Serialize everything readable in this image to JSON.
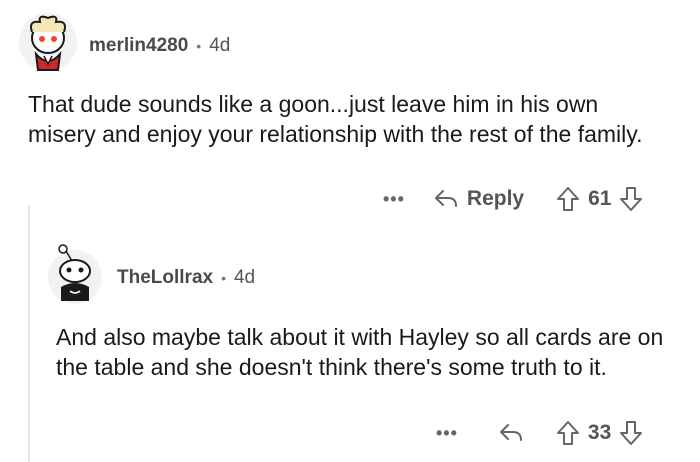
{
  "comments": [
    {
      "username": "merlin4280",
      "age": "4d",
      "text": "That dude sounds like a goon...just leave him in his own misery and enjoy your relationship with the rest of the family.",
      "more_label": "•••",
      "reply_label": "Reply",
      "score": "61"
    },
    {
      "username": "TheLollrax",
      "age": "4d",
      "text": "And also maybe talk about it with Hayley so all cards are on the table and she doesn't think there's some truth to it.",
      "more_label": "•••",
      "reply_label": "",
      "score": "33"
    }
  ],
  "separator": "•",
  "icons": {
    "reply": "reply-arrow-icon",
    "upvote": "upvote-arrow-icon",
    "downvote": "downvote-arrow-icon"
  }
}
